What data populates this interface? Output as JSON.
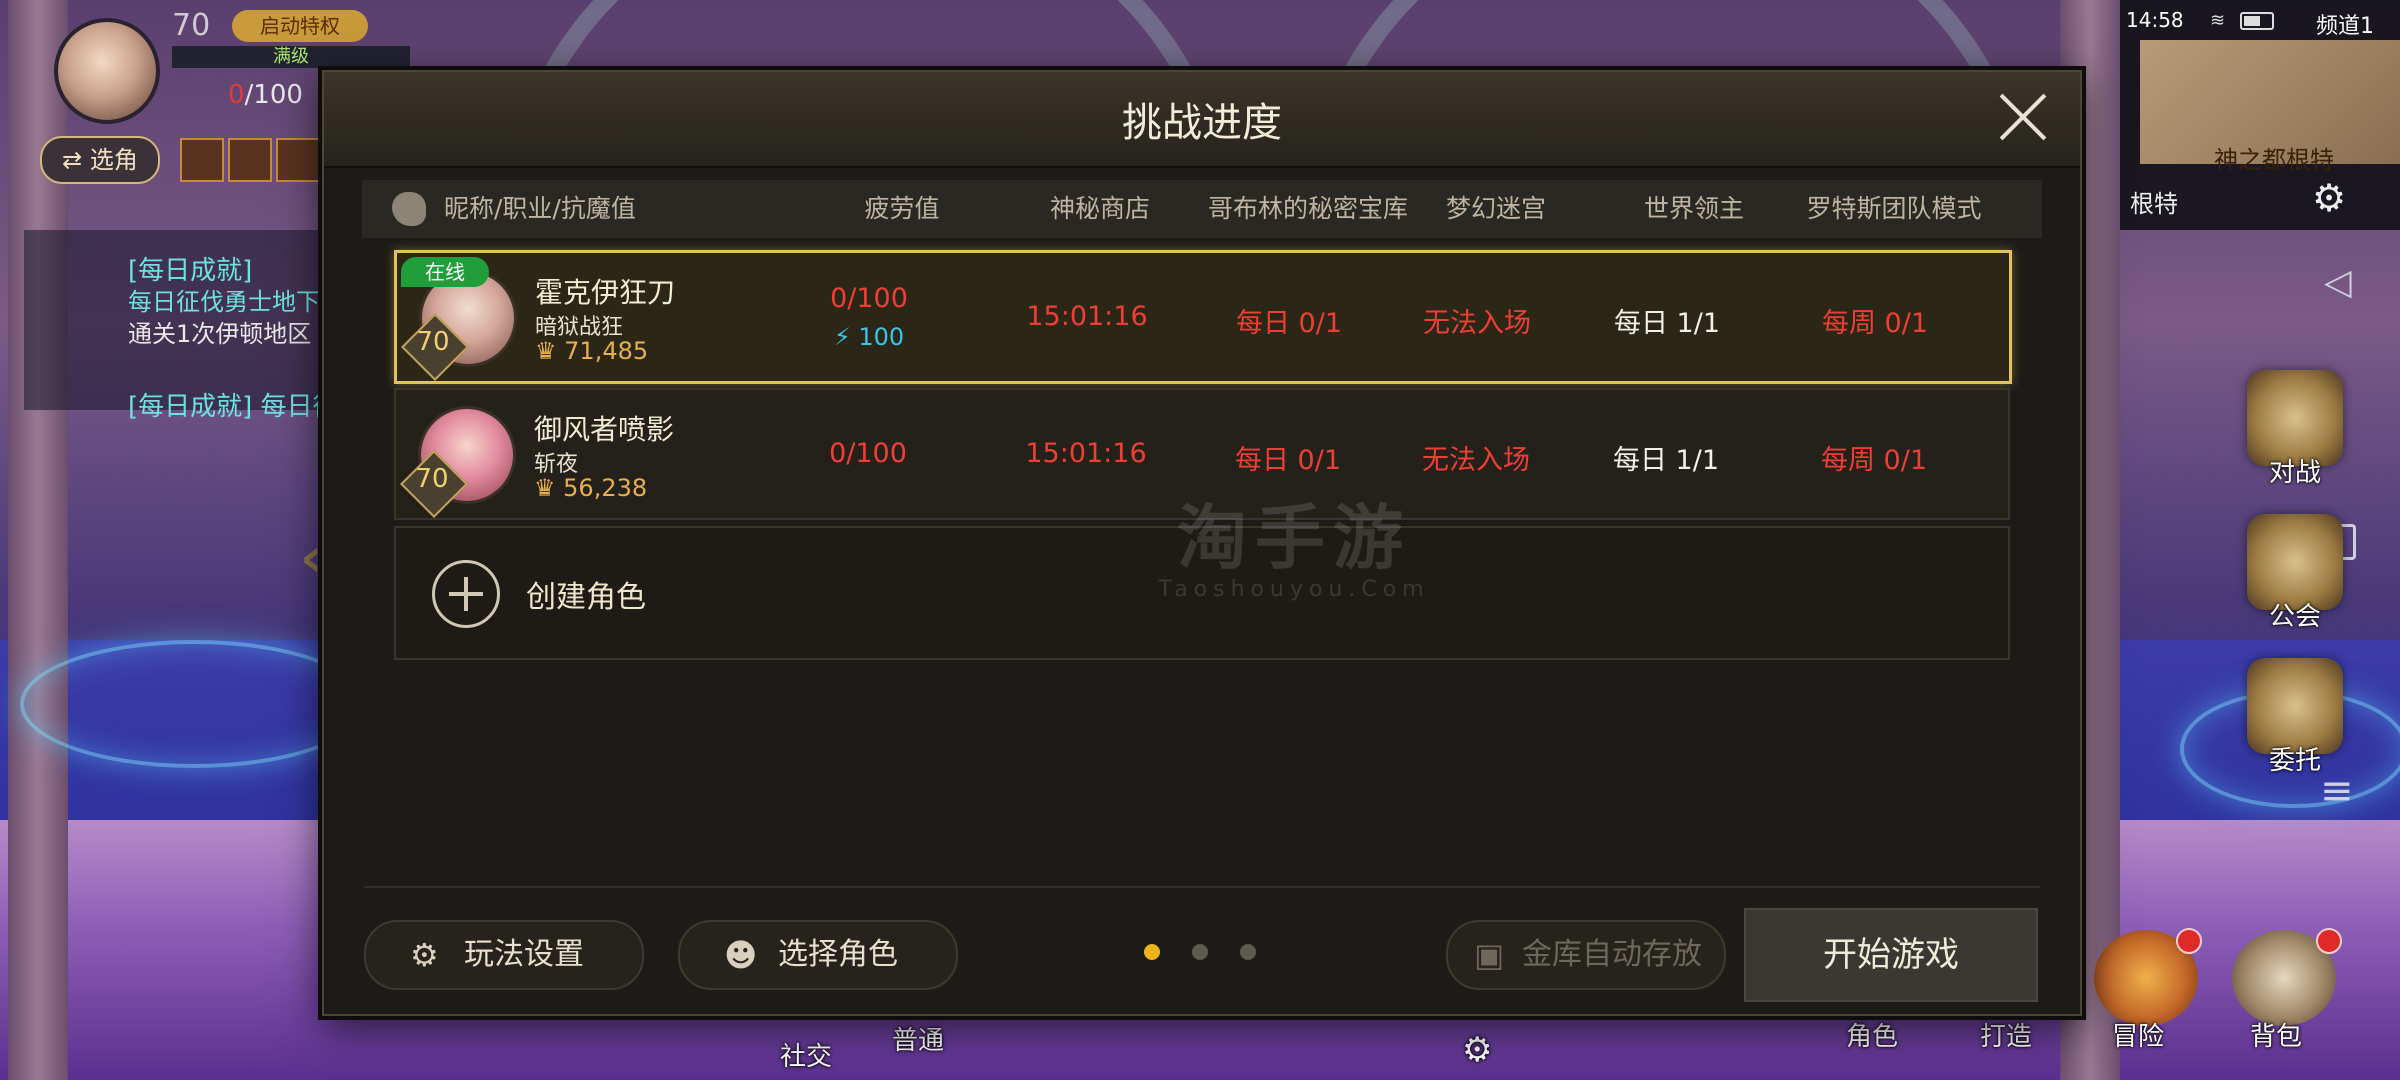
{
  "hud": {
    "level": "70",
    "privilege_label": "启动特权",
    "full_level_label": "满级",
    "stamina_current": "0",
    "stamina_max": "/100",
    "switch_role_label": "⇄ 选角",
    "quest_title": "[每日成就]",
    "quest_line1": "每日征伐勇士地下城",
    "quest_line2": "通关1次伊顿地区",
    "quest_title2": "[每日成就] 每日征伐"
  },
  "minimap": {
    "time": "14:58",
    "channel": "频道1",
    "location_text": "神之都根特",
    "root_label": "根特"
  },
  "side_buttons": [
    {
      "label": "对战"
    },
    {
      "label": "公会"
    },
    {
      "label": "委托"
    }
  ],
  "bottom_bar": {
    "social": "社交",
    "normal": "普通",
    "role": "角色",
    "craft": "打造",
    "adventure": "冒险",
    "bag": "背包"
  },
  "modal": {
    "title": "挑战进度",
    "columns": [
      "昵称/职业/抗魔值",
      "疲劳值",
      "神秘商店",
      "哥布林的秘密宝库",
      "梦幻迷宫",
      "世界领主",
      "罗特斯团队模式"
    ],
    "characters": [
      {
        "online_tag": "在线",
        "level": "70",
        "name": "霍克伊狂刀",
        "job": "暗狱战狂",
        "power": "71,485",
        "fatigue": "0/100",
        "fatigue_bonus": "100",
        "shop": "15:01:16",
        "goblin": "每日 0/1",
        "maze": "无法入场",
        "world_boss": "每日 1/1",
        "lotus": "每周 0/1"
      },
      {
        "level": "70",
        "name": "御风者喷影",
        "job": "斩夜",
        "power": "56,238",
        "fatigue": "0/100",
        "shop": "15:01:16",
        "goblin": "每日 0/1",
        "maze": "无法入场",
        "world_boss": "每日 1/1",
        "lotus": "每周 0/1"
      }
    ],
    "create_label": "创建角色",
    "watermark_cn": "淘手游",
    "watermark_en": "Taoshouyou.Com",
    "settings_button": "玩法设置",
    "select_button": "选择角色",
    "vault_button": "金库自动存放",
    "start_button": "开始游戏",
    "page_count": 3,
    "current_page": 1
  },
  "colors": {
    "accent_gold": "#e1c25e",
    "alert_red": "#ef3f35",
    "online_green": "#1f9e3a",
    "page_dot_active": "#f0b41a"
  }
}
